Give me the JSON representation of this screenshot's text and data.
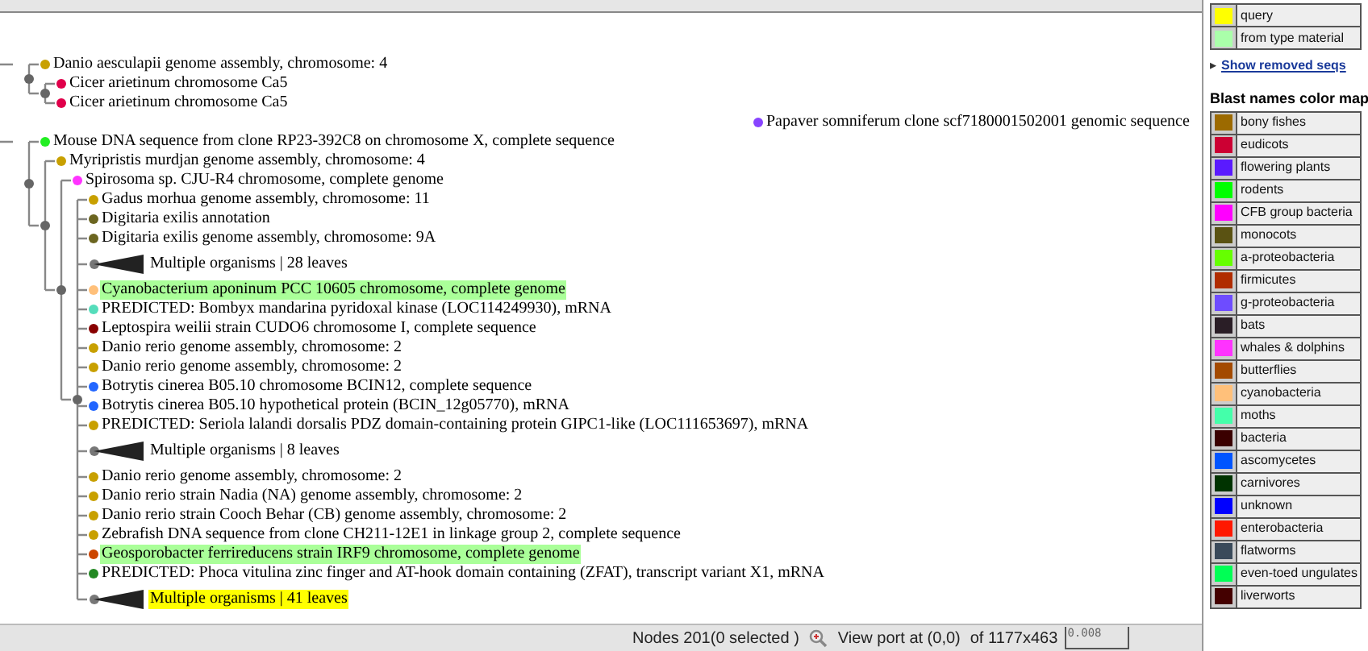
{
  "tree": {
    "children": [
      {
        "children": [
          {
            "label": "Danio aesculapii genome assembly, chromosome: 4",
            "kind": "leaf",
            "color": "#c8a000"
          },
          {
            "children": [
              {
                "label": "Cicer arietinum chromosome Ca5",
                "kind": "leaf",
                "color": "#e0004a"
              },
              {
                "label": "Cicer arietinum chromosome Ca5",
                "kind": "leaf",
                "color": "#e0004a"
              }
            ]
          }
        ]
      },
      {
        "label": "Papaver somniferum clone scf7180001502001 genomic sequence",
        "kind": "long-leaf",
        "color": "#8844ff"
      },
      {
        "children": [
          {
            "label": "Mouse DNA sequence from clone RP23-392C8 on chromosome X, complete sequence",
            "kind": "leaf",
            "color": "#22ee22"
          },
          {
            "children": [
              {
                "label": "Myripristis murdjan genome assembly, chromosome: 4",
                "kind": "leaf",
                "color": "#c8a000"
              },
              {
                "children": [
                  {
                    "label": "Spirosoma sp. CJU-R4 chromosome, complete genome",
                    "kind": "leaf",
                    "color": "#ff33ff"
                  },
                  {
                    "children": [
                      {
                        "label": "Gadus morhua genome assembly, chromosome: 11",
                        "kind": "leaf",
                        "color": "#c8a000"
                      },
                      {
                        "label": "Digitaria exilis annotation",
                        "kind": "leaf",
                        "color": "#6b6520"
                      },
                      {
                        "label": "Digitaria exilis genome assembly, chromosome: 9A",
                        "kind": "leaf",
                        "color": "#6b6520"
                      },
                      {
                        "label": "Multiple organisms | 28 leaves",
                        "kind": "collapsed"
                      },
                      {
                        "label": "Cyanobacterium aponinum PCC 10605 chromosome, complete genome",
                        "kind": "leaf",
                        "color": "#ffc07a",
                        "from_type_material": true
                      },
                      {
                        "label": "PREDICTED: Bombyx mandarina pyridoxal kinase (LOC114249930), mRNA",
                        "kind": "leaf",
                        "color": "#55ddbb"
                      },
                      {
                        "label": "Leptospira weilii strain CUDO6 chromosome I, complete sequence",
                        "kind": "leaf",
                        "color": "#880000"
                      },
                      {
                        "label": "Danio rerio genome assembly, chromosome: 2",
                        "kind": "leaf",
                        "color": "#c8a000"
                      },
                      {
                        "label": "Danio rerio genome assembly, chromosome: 2",
                        "kind": "leaf",
                        "color": "#c8a000"
                      },
                      {
                        "label": "Botrytis cinerea B05.10 chromosome BCIN12, complete sequence",
                        "kind": "leaf",
                        "color": "#2266ff"
                      },
                      {
                        "label": "Botrytis cinerea B05.10 hypothetical protein (BCIN_12g05770), mRNA",
                        "kind": "leaf",
                        "color": "#2266ff"
                      },
                      {
                        "label": "PREDICTED: Seriola lalandi dorsalis PDZ domain-containing protein GIPC1-like (LOC111653697), mRNA",
                        "kind": "leaf",
                        "color": "#c8a000"
                      },
                      {
                        "label": "Multiple organisms | 8 leaves",
                        "kind": "collapsed"
                      },
                      {
                        "label": "Danio rerio genome assembly, chromosome: 2",
                        "kind": "leaf",
                        "color": "#c8a000"
                      },
                      {
                        "label": "Danio rerio strain Nadia (NA) genome assembly, chromosome: 2",
                        "kind": "leaf",
                        "color": "#c8a000"
                      },
                      {
                        "label": "Danio rerio strain Cooch Behar (CB) genome assembly, chromosome: 2",
                        "kind": "leaf",
                        "color": "#c8a000"
                      },
                      {
                        "label": "Zebrafish DNA sequence from clone CH211-12E1 in linkage group 2, complete sequence",
                        "kind": "leaf",
                        "color": "#c8a000"
                      },
                      {
                        "label": "Geosporobacter ferrireducens strain IRF9 chromosome, complete genome",
                        "kind": "leaf",
                        "color": "#cc4400",
                        "from_type_material": true
                      },
                      {
                        "label": "PREDICTED: Phoca vitulina zinc finger and AT-hook domain containing (ZFAT), transcript variant X1, mRNA",
                        "kind": "leaf",
                        "color": "#228822"
                      },
                      {
                        "label": "Multiple organisms | 41 leaves",
                        "kind": "collapsed",
                        "query": true
                      }
                    ]
                  }
                ]
              }
            ]
          }
        ]
      }
    ]
  },
  "status_bar": {
    "nodes": "Nodes 201(0 selected )",
    "viewport": "View port at (0,0)",
    "size": "of 1177x463",
    "scale": "0.008"
  },
  "legend": {
    "items": [
      {
        "label": "query",
        "color": "#ffff00"
      },
      {
        "label": "from type material",
        "color": "#aaffaa"
      }
    ],
    "link": "Show removed seqs",
    "link_arrow": "▸"
  },
  "color_map": {
    "title": "Blast names color map",
    "items": [
      {
        "label": "bony fishes",
        "color": "#9c6a00"
      },
      {
        "label": "eudicots",
        "color": "#cc0033"
      },
      {
        "label": "flowering plants",
        "color": "#5a1aff"
      },
      {
        "label": "rodents",
        "color": "#00ff00"
      },
      {
        "label": "CFB group bacteria",
        "color": "#ff00ff"
      },
      {
        "label": "monocots",
        "color": "#5a5212"
      },
      {
        "label": "a-proteobacteria",
        "color": "#66ff00"
      },
      {
        "label": "firmicutes",
        "color": "#b02c00"
      },
      {
        "label": "g-proteobacteria",
        "color": "#6e4cff"
      },
      {
        "label": "bats",
        "color": "#2a1e26"
      },
      {
        "label": "whales & dolphins",
        "color": "#ff33ff"
      },
      {
        "label": "butterflies",
        "color": "#a34a00"
      },
      {
        "label": "cyanobacteria",
        "color": "#ffc07a"
      },
      {
        "label": "moths",
        "color": "#44ffaa"
      },
      {
        "label": "bacteria",
        "color": "#3a0000"
      },
      {
        "label": "ascomycetes",
        "color": "#0055ff"
      },
      {
        "label": "carnivores",
        "color": "#003300"
      },
      {
        "label": "unknown",
        "color": "#0000ff"
      },
      {
        "label": "enterobacteria",
        "color": "#ff1800"
      },
      {
        "label": "flatworms",
        "color": "#3a4a5a"
      },
      {
        "label": "even-toed ungulates",
        "color": "#00ff55"
      },
      {
        "label": "liverworts",
        "color": "#440000"
      }
    ]
  }
}
